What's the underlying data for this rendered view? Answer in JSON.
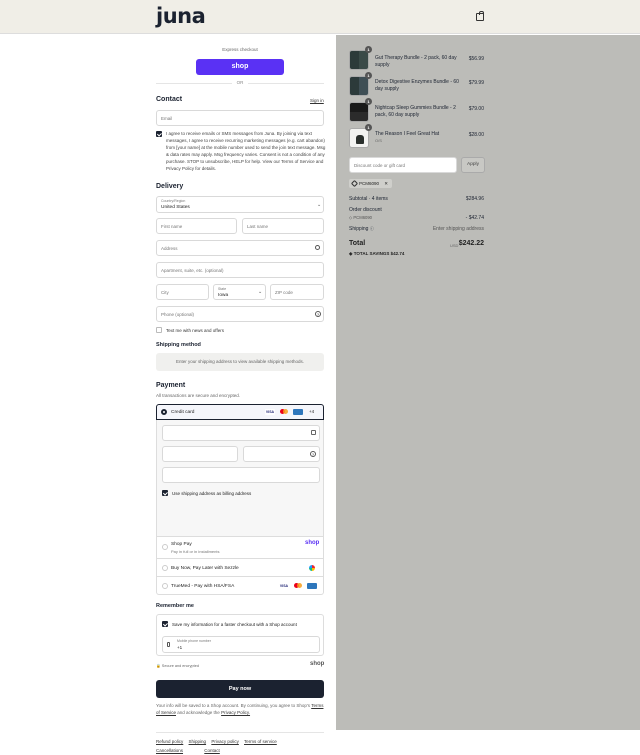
{
  "brand": {
    "logo": "juna"
  },
  "express": {
    "title": "Express checkout",
    "shop_button": "shop",
    "or": "OR"
  },
  "contact": {
    "title": "Contact",
    "sign_in": "Sign in",
    "email_placeholder": "Email",
    "consent_text": "I agree to receive emails or SMS messages from Juna. By joining via text messages, I agree to receive recurring marketing messages (e.g. cart abandon) from [your name] at the mobile number used to send the join text message. Msg & data rates may apply. Msg frequency varies. Consent is not a condition of any purchase. STOP to unsubscribe, HELP for help. View our Terms of Service and Privacy Policy for details."
  },
  "delivery": {
    "title": "Delivery",
    "country_label": "Country/Region",
    "country_value": "United States",
    "first_name": "First name",
    "last_name": "Last name",
    "address": "Address",
    "apartment": "Apartment, suite, etc. (optional)",
    "city": "City",
    "state_label": "State",
    "state_value": "Iowa",
    "zip": "ZIP code",
    "phone": "Phone (optional)",
    "news_offers": "Text me with news and offers"
  },
  "shipping_method": {
    "title": "Shipping method",
    "notice": "Enter your shipping address to view available shipping methods."
  },
  "payment": {
    "title": "Payment",
    "subtitle": "All transactions are secure and encrypted.",
    "credit_card": "Credit card",
    "more_cards": "+4",
    "billing_same": "Use shipping address as billing address",
    "shop_pay_title": "Shop Pay",
    "shop_pay_sub": "Pay in full or in installments",
    "shop_pay_logo": "shop",
    "sezzle": "Buy Now, Pay Later with Sezzle",
    "truemed": "TrueMed - Pay with HSA/FSA"
  },
  "remember": {
    "title": "Remember me",
    "save_info": "Save my information for a faster checkout with a Shop account",
    "mobile_label": "Mobile phone number",
    "mobile_value": "+1",
    "secure": "Secure and encrypted",
    "shop_logo": "shop"
  },
  "pay_now": "Pay now",
  "terms_note_1": "Your info will be saved to a Shop account. By continuing, you agree to Shop's",
  "terms_note_link1": "Terms of Service",
  "terms_note_2": "and acknowledge the",
  "terms_note_link2": "Privacy Policy.",
  "footer_links": [
    "Refund policy",
    "Shipping",
    "Privacy policy",
    "Terms of service",
    "Cancellations",
    "Contact"
  ],
  "cart": {
    "items": [
      {
        "name": "Gut Therapy Bundle - 2 pack, 60 day supply",
        "qty": "1",
        "price": "$56.99",
        "variant": ""
      },
      {
        "name": "Detox Digestive Enzymes Bundle - 60 day supply",
        "qty": "1",
        "price": "$79.99",
        "variant": ""
      },
      {
        "name": "Nightcap Sleep Gummies Bundle - 2 pack, 60 day supply",
        "qty": "1",
        "price": "$79.00",
        "variant": ""
      },
      {
        "name": "The Reason I Feel Great Hat",
        "qty": "1",
        "price": "$28.00",
        "variant": "O/S"
      }
    ],
    "discount_placeholder": "Discount code or gift card",
    "apply": "Apply",
    "code_tag": "PCM6090",
    "subtotal_label": "Subtotal · 4 items",
    "subtotal_value": "$284.96",
    "order_discount": "Order discount",
    "discount_code": "PCM6090",
    "discount_value": "- $42.74",
    "shipping_label": "Shipping",
    "shipping_value": "Enter shipping address",
    "total_label": "Total",
    "currency": "USD",
    "total_value": "$242.22",
    "savings_label": "TOTAL SAVINGS",
    "savings_value": "$42.74"
  },
  "colors": {
    "shop_purple": "#5a31f4",
    "navy": "#1b2230",
    "right_bg": "#bcbcb8",
    "header_bg": "#f0eee7"
  }
}
